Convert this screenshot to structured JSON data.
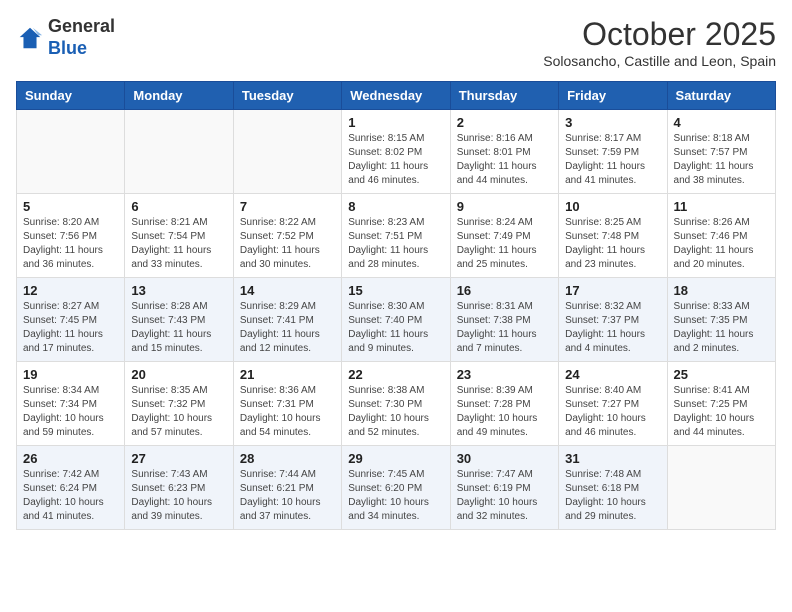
{
  "header": {
    "logo_line1": "General",
    "logo_line2": "Blue",
    "month": "October 2025",
    "location": "Solosancho, Castille and Leon, Spain"
  },
  "weekdays": [
    "Sunday",
    "Monday",
    "Tuesday",
    "Wednesday",
    "Thursday",
    "Friday",
    "Saturday"
  ],
  "weeks": [
    [
      {
        "day": "",
        "info": ""
      },
      {
        "day": "",
        "info": ""
      },
      {
        "day": "",
        "info": ""
      },
      {
        "day": "1",
        "info": "Sunrise: 8:15 AM\nSunset: 8:02 PM\nDaylight: 11 hours and 46 minutes."
      },
      {
        "day": "2",
        "info": "Sunrise: 8:16 AM\nSunset: 8:01 PM\nDaylight: 11 hours and 44 minutes."
      },
      {
        "day": "3",
        "info": "Sunrise: 8:17 AM\nSunset: 7:59 PM\nDaylight: 11 hours and 41 minutes."
      },
      {
        "day": "4",
        "info": "Sunrise: 8:18 AM\nSunset: 7:57 PM\nDaylight: 11 hours and 38 minutes."
      }
    ],
    [
      {
        "day": "5",
        "info": "Sunrise: 8:20 AM\nSunset: 7:56 PM\nDaylight: 11 hours and 36 minutes."
      },
      {
        "day": "6",
        "info": "Sunrise: 8:21 AM\nSunset: 7:54 PM\nDaylight: 11 hours and 33 minutes."
      },
      {
        "day": "7",
        "info": "Sunrise: 8:22 AM\nSunset: 7:52 PM\nDaylight: 11 hours and 30 minutes."
      },
      {
        "day": "8",
        "info": "Sunrise: 8:23 AM\nSunset: 7:51 PM\nDaylight: 11 hours and 28 minutes."
      },
      {
        "day": "9",
        "info": "Sunrise: 8:24 AM\nSunset: 7:49 PM\nDaylight: 11 hours and 25 minutes."
      },
      {
        "day": "10",
        "info": "Sunrise: 8:25 AM\nSunset: 7:48 PM\nDaylight: 11 hours and 23 minutes."
      },
      {
        "day": "11",
        "info": "Sunrise: 8:26 AM\nSunset: 7:46 PM\nDaylight: 11 hours and 20 minutes."
      }
    ],
    [
      {
        "day": "12",
        "info": "Sunrise: 8:27 AM\nSunset: 7:45 PM\nDaylight: 11 hours and 17 minutes."
      },
      {
        "day": "13",
        "info": "Sunrise: 8:28 AM\nSunset: 7:43 PM\nDaylight: 11 hours and 15 minutes."
      },
      {
        "day": "14",
        "info": "Sunrise: 8:29 AM\nSunset: 7:41 PM\nDaylight: 11 hours and 12 minutes."
      },
      {
        "day": "15",
        "info": "Sunrise: 8:30 AM\nSunset: 7:40 PM\nDaylight: 11 hours and 9 minutes."
      },
      {
        "day": "16",
        "info": "Sunrise: 8:31 AM\nSunset: 7:38 PM\nDaylight: 11 hours and 7 minutes."
      },
      {
        "day": "17",
        "info": "Sunrise: 8:32 AM\nSunset: 7:37 PM\nDaylight: 11 hours and 4 minutes."
      },
      {
        "day": "18",
        "info": "Sunrise: 8:33 AM\nSunset: 7:35 PM\nDaylight: 11 hours and 2 minutes."
      }
    ],
    [
      {
        "day": "19",
        "info": "Sunrise: 8:34 AM\nSunset: 7:34 PM\nDaylight: 10 hours and 59 minutes."
      },
      {
        "day": "20",
        "info": "Sunrise: 8:35 AM\nSunset: 7:32 PM\nDaylight: 10 hours and 57 minutes."
      },
      {
        "day": "21",
        "info": "Sunrise: 8:36 AM\nSunset: 7:31 PM\nDaylight: 10 hours and 54 minutes."
      },
      {
        "day": "22",
        "info": "Sunrise: 8:38 AM\nSunset: 7:30 PM\nDaylight: 10 hours and 52 minutes."
      },
      {
        "day": "23",
        "info": "Sunrise: 8:39 AM\nSunset: 7:28 PM\nDaylight: 10 hours and 49 minutes."
      },
      {
        "day": "24",
        "info": "Sunrise: 8:40 AM\nSunset: 7:27 PM\nDaylight: 10 hours and 46 minutes."
      },
      {
        "day": "25",
        "info": "Sunrise: 8:41 AM\nSunset: 7:25 PM\nDaylight: 10 hours and 44 minutes."
      }
    ],
    [
      {
        "day": "26",
        "info": "Sunrise: 7:42 AM\nSunset: 6:24 PM\nDaylight: 10 hours and 41 minutes."
      },
      {
        "day": "27",
        "info": "Sunrise: 7:43 AM\nSunset: 6:23 PM\nDaylight: 10 hours and 39 minutes."
      },
      {
        "day": "28",
        "info": "Sunrise: 7:44 AM\nSunset: 6:21 PM\nDaylight: 10 hours and 37 minutes."
      },
      {
        "day": "29",
        "info": "Sunrise: 7:45 AM\nSunset: 6:20 PM\nDaylight: 10 hours and 34 minutes."
      },
      {
        "day": "30",
        "info": "Sunrise: 7:47 AM\nSunset: 6:19 PM\nDaylight: 10 hours and 32 minutes."
      },
      {
        "day": "31",
        "info": "Sunrise: 7:48 AM\nSunset: 6:18 PM\nDaylight: 10 hours and 29 minutes."
      },
      {
        "day": "",
        "info": ""
      }
    ]
  ]
}
